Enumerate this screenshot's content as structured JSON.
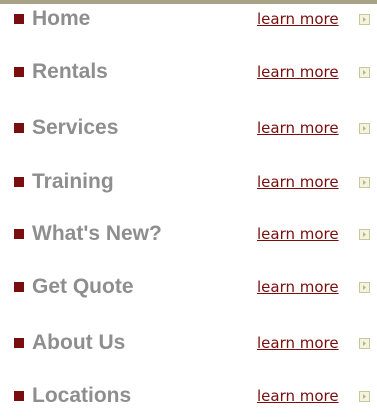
{
  "colors": {
    "accent": "#7a0e0e",
    "nav_text": "#8e8e8e",
    "top_strip": "#a8a386",
    "arrow_box": "#f4f3dc"
  },
  "link_icon": "arrow-right-icon",
  "nav": {
    "items": [
      {
        "label": "Home",
        "link": "learn more"
      },
      {
        "label": "Rentals",
        "link": "learn more"
      },
      {
        "label": "Services",
        "link": "learn more"
      },
      {
        "label": "Training",
        "link": "learn more"
      },
      {
        "label": "What's New?",
        "link": "learn more"
      },
      {
        "label": "Get Quote",
        "link": "learn more"
      },
      {
        "label": "About Us",
        "link": "learn more"
      },
      {
        "label": "Locations",
        "link": "learn more"
      }
    ]
  }
}
